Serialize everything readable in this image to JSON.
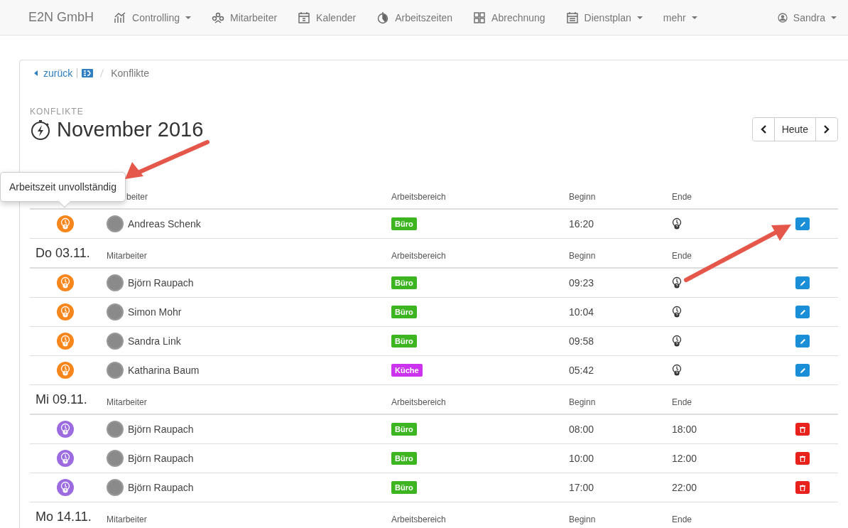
{
  "navbar": {
    "brand": "E2N GmbH",
    "items": [
      {
        "label": "Controlling",
        "dropdown": true
      },
      {
        "label": "Mitarbeiter",
        "dropdown": false
      },
      {
        "label": "Kalender",
        "dropdown": false
      },
      {
        "label": "Arbeitszeiten",
        "dropdown": false
      },
      {
        "label": "Abrechnung",
        "dropdown": false
      },
      {
        "label": "Dienstplan",
        "dropdown": true
      },
      {
        "label": "mehr",
        "dropdown": true
      }
    ],
    "user": "Sandra"
  },
  "breadcrumb": {
    "back": "zurück",
    "current": "Konflikte"
  },
  "header": {
    "kicker": "KONFLIKTE",
    "title": "November 2016"
  },
  "pager": {
    "today": "Heute"
  },
  "tooltip": "Arbeitszeit unvollständig",
  "groups": [
    {
      "columns": [
        "beiter",
        "Arbeitsbereich",
        "Beginn",
        "Ende"
      ],
      "rows": [
        {
          "kind": "incomplete",
          "name": "Andreas Schenk",
          "area": "Büro",
          "color": "#3cb521",
          "begin": "16:20"
        }
      ]
    },
    {
      "date": "Do 03.11.",
      "columns": [
        "Mitarbeiter",
        "Arbeitsbereich",
        "Beginn",
        "Ende"
      ],
      "rows": [
        {
          "kind": "incomplete",
          "name": "Björn Raupach",
          "area": "Büro",
          "color": "#3cb521",
          "begin": "09:23"
        },
        {
          "kind": "incomplete",
          "name": "Simon Mohr",
          "area": "Büro",
          "color": "#3cb521",
          "begin": "10:04"
        },
        {
          "kind": "incomplete",
          "name": "Sandra Link",
          "area": "Büro",
          "color": "#3cb521",
          "begin": "09:58"
        },
        {
          "kind": "incomplete",
          "name": "Katharina Baum",
          "area": "Küche",
          "color": "#cc33ee",
          "begin": "05:42"
        }
      ]
    },
    {
      "date": "Mi 09.11.",
      "columns": [
        "Mitarbeiter",
        "Arbeitsbereich",
        "Beginn",
        "Ende"
      ],
      "rows": [
        {
          "kind": "overlap",
          "name": "Björn Raupach",
          "area": "Büro",
          "color": "#3cb521",
          "begin": "08:00",
          "end": "18:00"
        },
        {
          "kind": "overlap",
          "name": "Björn Raupach",
          "area": "Büro",
          "color": "#3cb521",
          "begin": "10:00",
          "end": "12:00"
        },
        {
          "kind": "overlap",
          "name": "Björn Raupach",
          "area": "Büro",
          "color": "#3cb521",
          "begin": "17:00",
          "end": "22:00"
        }
      ]
    },
    {
      "date": "Mo 14.11.",
      "columns": [
        "Mitarbeiter",
        "Arbeitsbereich",
        "Beginn",
        "Ende"
      ]
    }
  ]
}
